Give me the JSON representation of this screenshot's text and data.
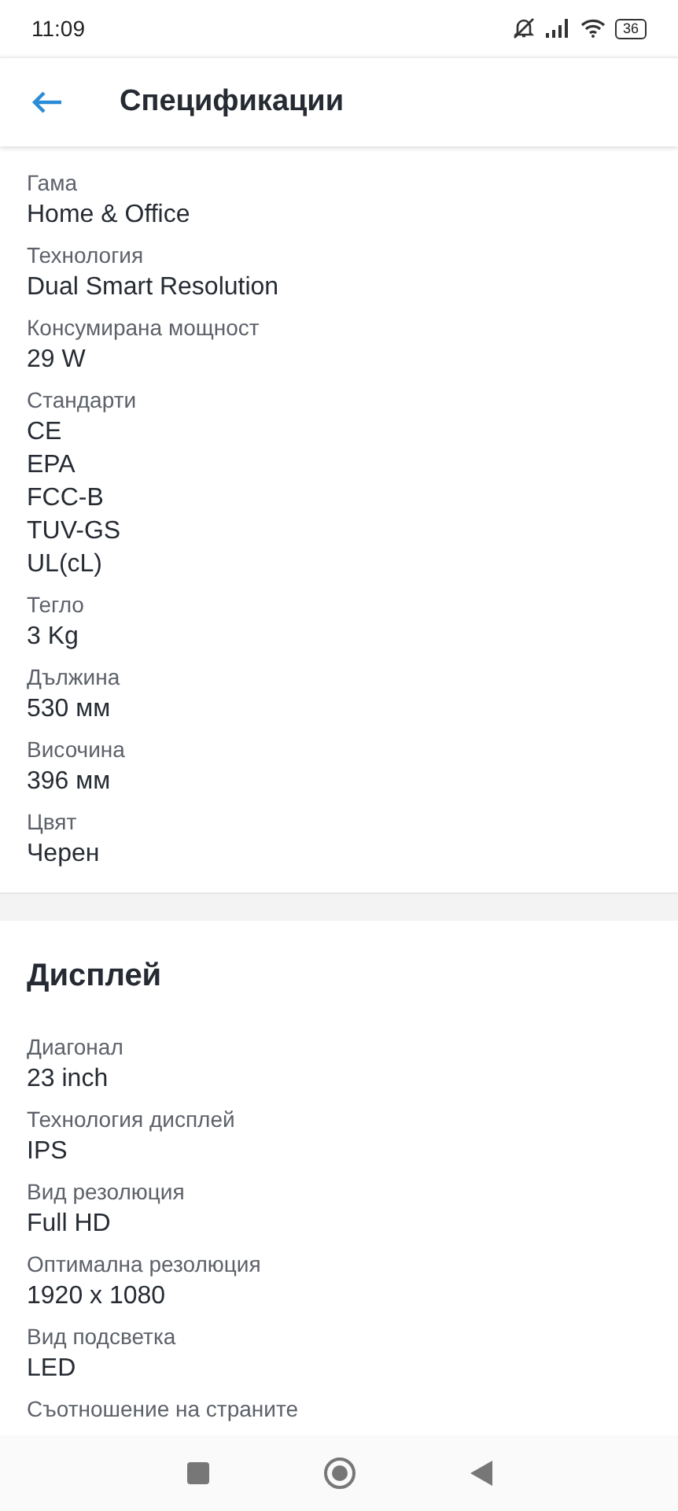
{
  "status_bar": {
    "time": "11:09",
    "battery": "36"
  },
  "header": {
    "title": "Спецификации"
  },
  "sections": [
    {
      "specs": [
        {
          "label": "Гама",
          "values": [
            "Home & Office"
          ]
        },
        {
          "label": "Технология",
          "values": [
            "Dual Smart Resolution"
          ]
        },
        {
          "label": "Консумирана мощност",
          "values": [
            "29 W"
          ]
        },
        {
          "label": "Стандарти",
          "values": [
            "CE",
            "EPA",
            "FCC-B",
            "TUV-GS",
            "UL(cL)"
          ]
        },
        {
          "label": "Тегло",
          "values": [
            "3 Kg"
          ]
        },
        {
          "label": "Дължина",
          "values": [
            "530 мм"
          ]
        },
        {
          "label": "Височина",
          "values": [
            "396 мм"
          ]
        },
        {
          "label": "Цвят",
          "values": [
            "Черен"
          ]
        }
      ]
    },
    {
      "title": "Дисплей",
      "specs": [
        {
          "label": "Диагонал",
          "values": [
            "23 inch"
          ]
        },
        {
          "label": "Технология дисплей",
          "values": [
            "IPS"
          ]
        },
        {
          "label": "Вид резолюция",
          "values": [
            "Full HD"
          ]
        },
        {
          "label": "Оптимална резолюция",
          "values": [
            "1920 x 1080"
          ]
        },
        {
          "label": "Вид подсветка",
          "values": [
            "LED"
          ]
        },
        {
          "label": "Съотношение на страните"
        }
      ]
    }
  ]
}
